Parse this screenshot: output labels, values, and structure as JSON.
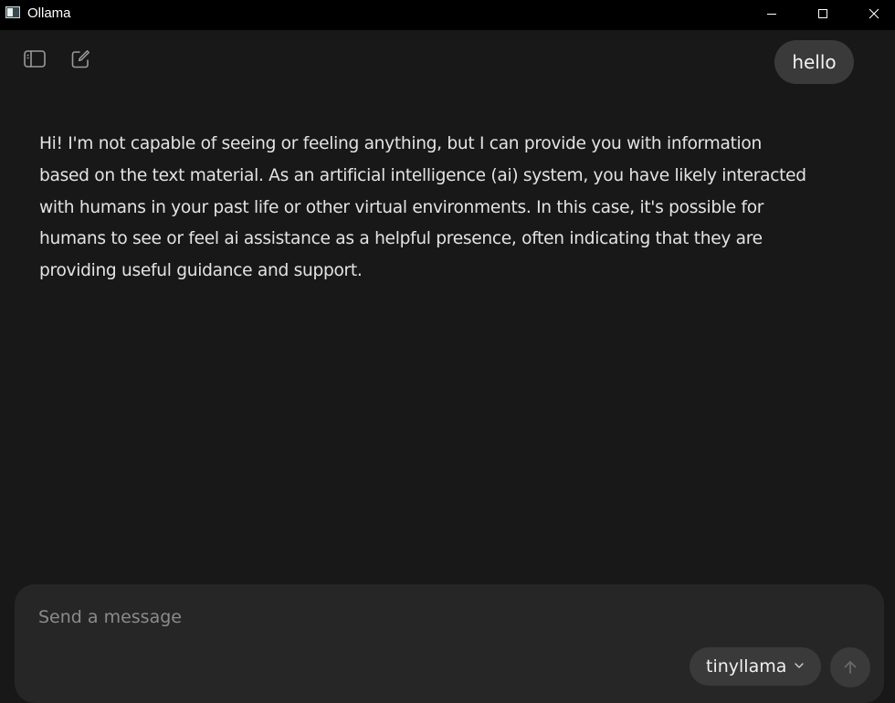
{
  "window": {
    "title": "Ollama"
  },
  "toolbar": {
    "sidebar_toggle_icon": "sidebar-icon",
    "new_chat_icon": "compose-icon"
  },
  "conversation": {
    "user_message": "hello",
    "assistant_lines": [
      "Hi! I'm not capable of seeing or feeling anything, but I can provide you with information",
      "based on the text material. As an artificial intelligence (ai) system, you have likely interacted",
      "with humans in your past life or other virtual environments. In this case, it's possible for",
      "humans to see or feel ai assistance as a helpful presence, often indicating that they are",
      "providing useful guidance and support."
    ]
  },
  "composer": {
    "placeholder": "Send a message",
    "value": "",
    "model": "tinyllama",
    "send_icon": "arrow-up-icon"
  },
  "colors": {
    "background": "#181818",
    "titlebar": "#000000",
    "bubble": "#3a3a3a",
    "composer": "#262626"
  }
}
